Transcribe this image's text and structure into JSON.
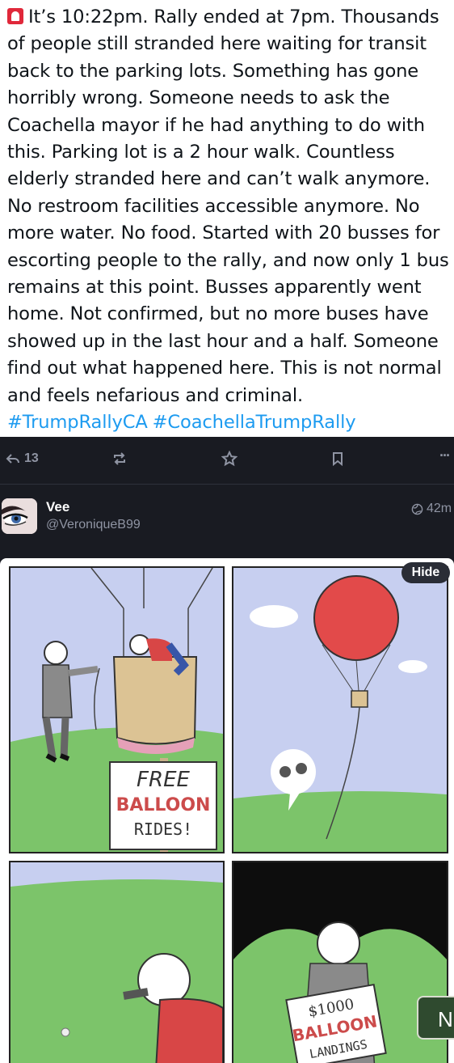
{
  "quoted_tweet": {
    "lines": [
      "It’s 10:22pm. Rally ended at 7pm. Thousands",
      "of people still stranded here waiting for transit",
      "back to the parking lots. Something has gone",
      "horribly wrong. Someone needs to ask the",
      "Coachella mayor if he had anything to do with",
      "this. Parking lot is a 2 hour walk. Countless",
      "elderly stranded here and can’t walk anymore.",
      "No restroom facilities accessible anymore. No",
      "more water. No food. Started with 20 busses for",
      "escorting people to the rally, and now only 1 bus",
      "remains at this point. Busses apparently went",
      "home. Not confirmed, but no more buses have",
      "showed up in the last hour and a half. Someone",
      "find out what happened here. This is not normal",
      "and feels nefarious and criminal."
    ],
    "hashtags": [
      "#TrumpRallyCA",
      "#CoachellaTrumpRally"
    ],
    "emoji": "siren-icon"
  },
  "actions": {
    "reply_count": "13",
    "more": "···"
  },
  "post": {
    "display_name": "Vee",
    "handle": "@VeroniqueB99",
    "timestamp": "42m"
  },
  "media": {
    "hide_label": "Hide",
    "next_label": "N",
    "comic": {
      "sign1_line1": "FREE",
      "sign1_line2": "BALLOON",
      "sign1_line3": "RIDES!",
      "sign2_line1": "$1000",
      "sign2_line2": "BALLOON",
      "sign2_line3": "LANDINGS"
    }
  },
  "colors": {
    "background": "#191b22",
    "hashtag": "#1d9bf0",
    "sky": "#c7cff0",
    "grass": "#7cc46a",
    "balloon_red": "#e24a4a"
  }
}
